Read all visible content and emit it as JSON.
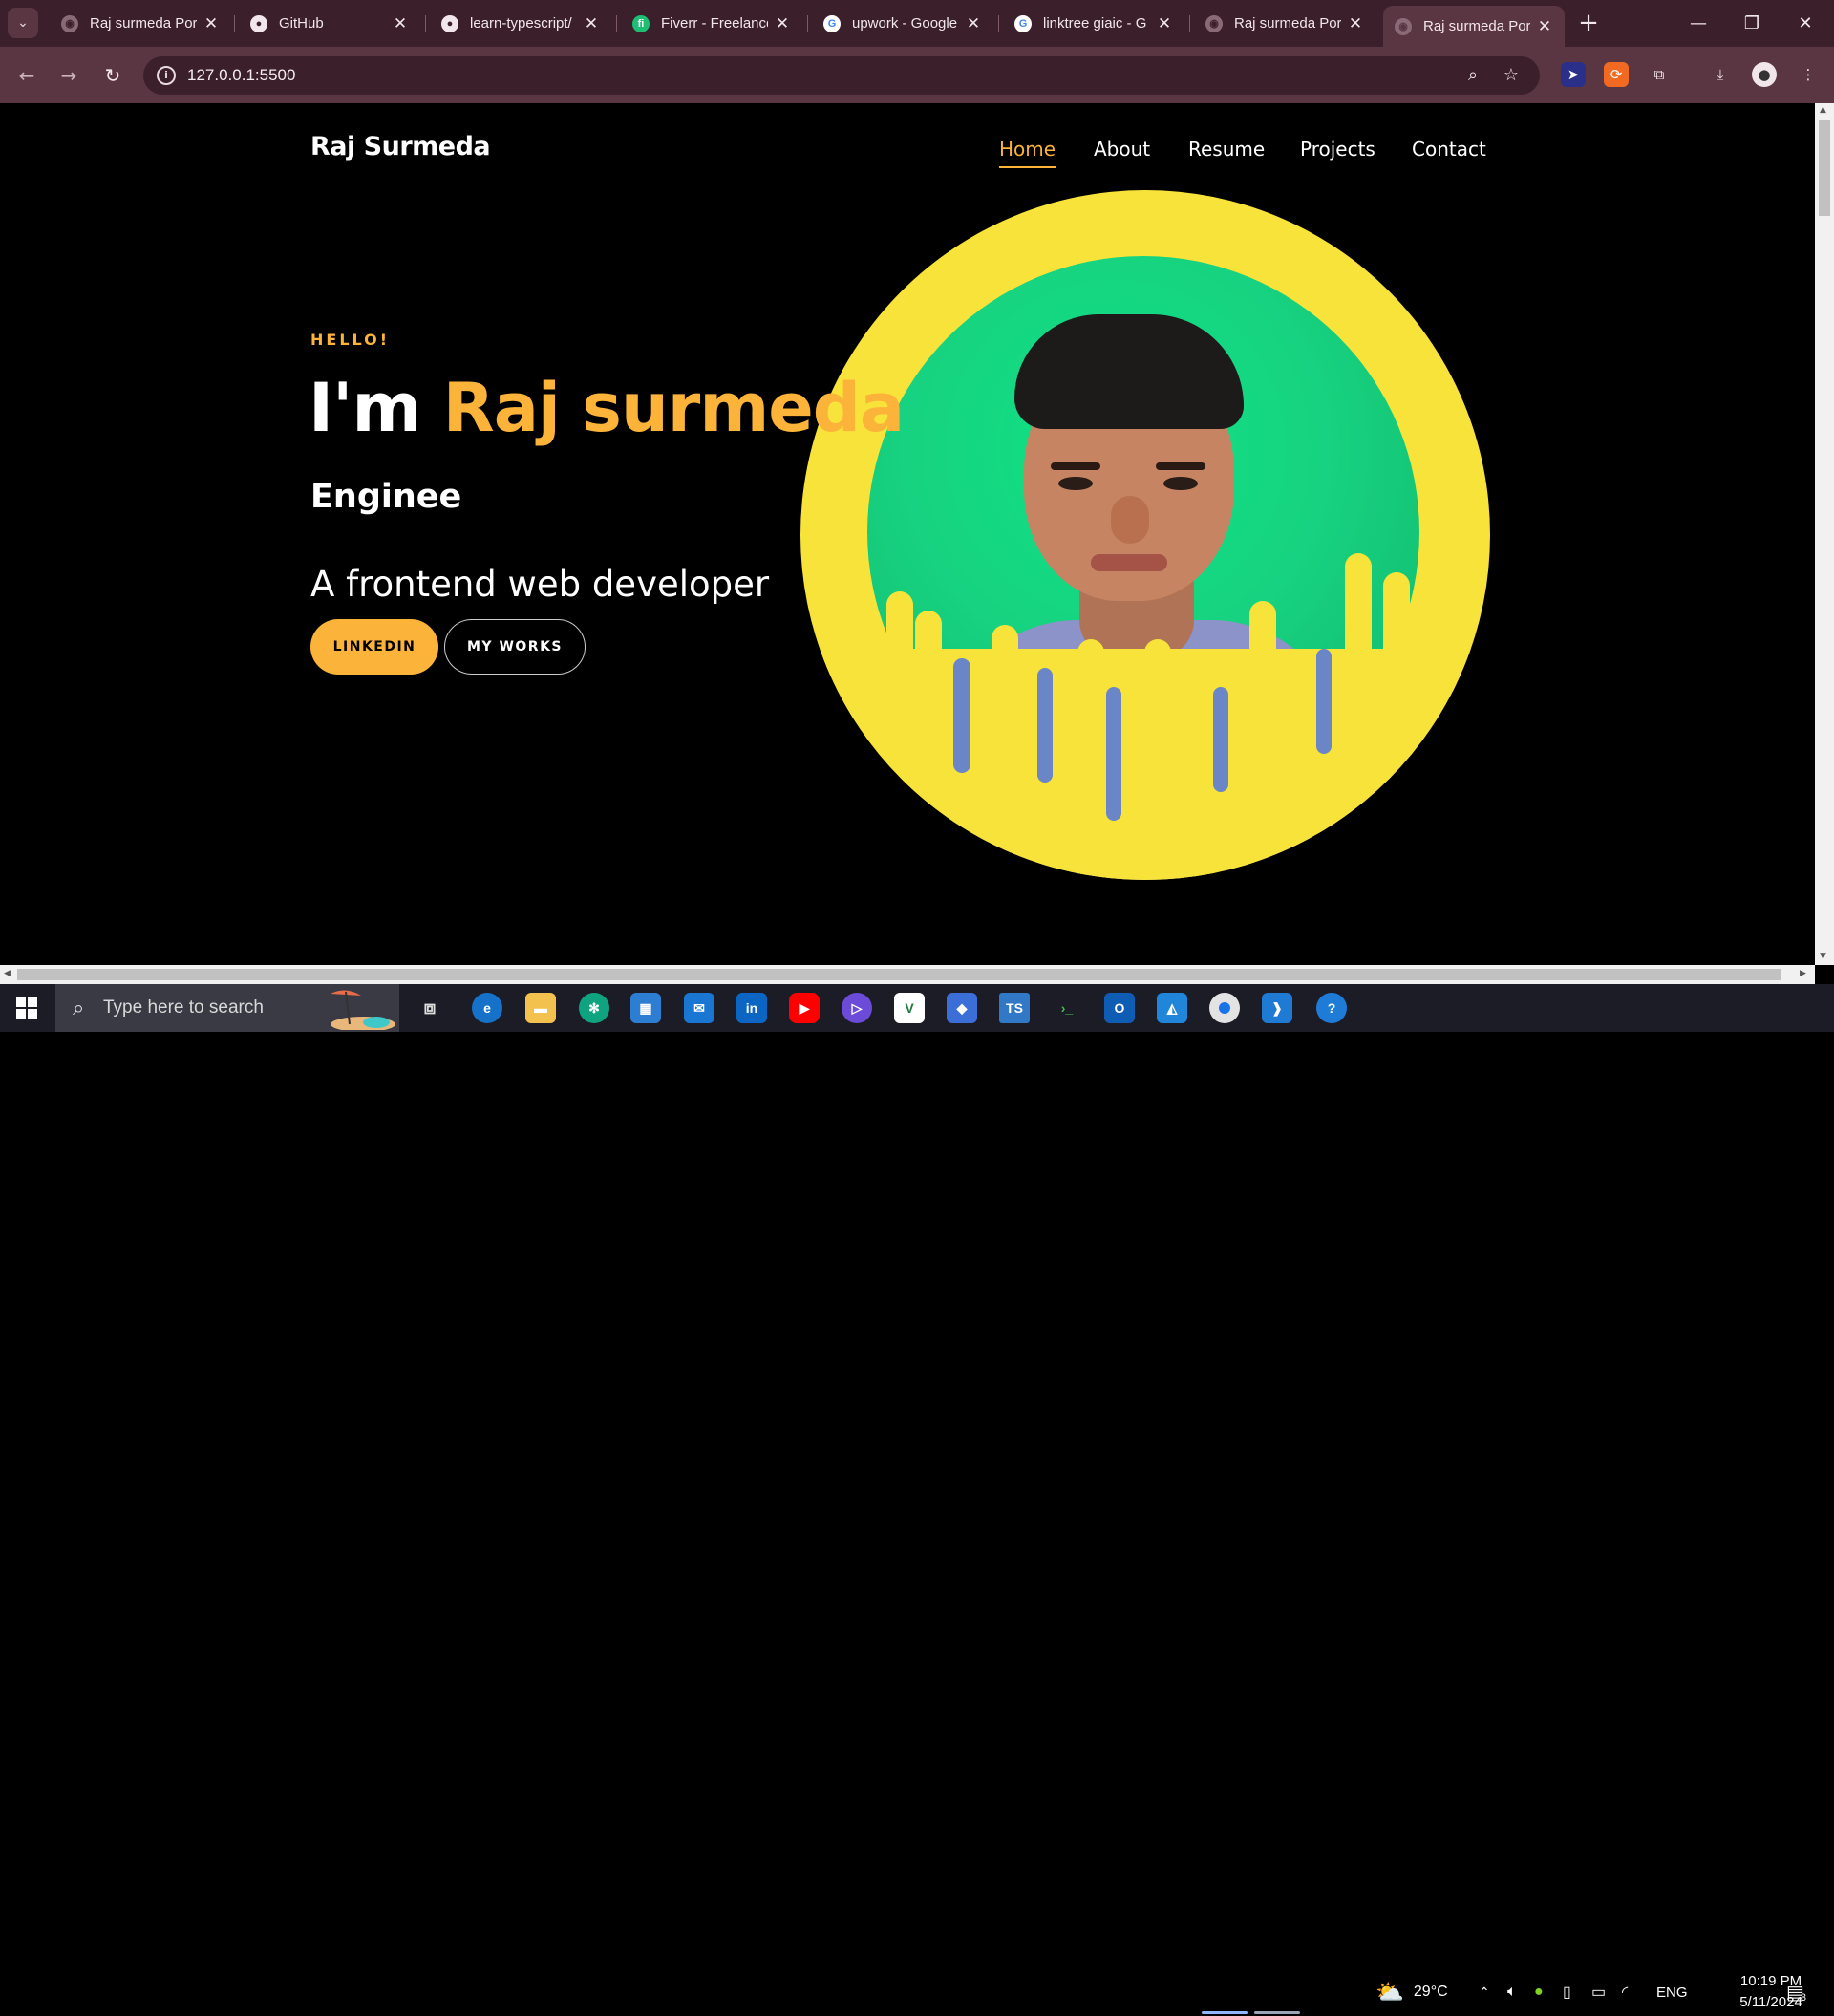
{
  "browser": {
    "tabs": [
      {
        "title": "Raj surmeda Port",
        "favicon": "globe"
      },
      {
        "title": "GitHub",
        "favicon": "github"
      },
      {
        "title": "learn-typescript/",
        "favicon": "github"
      },
      {
        "title": "Fiverr - Freelance",
        "favicon": "fiverr"
      },
      {
        "title": "upwork - Google",
        "favicon": "google"
      },
      {
        "title": "linktree giaic - G",
        "favicon": "google"
      },
      {
        "title": "Raj surmeda Port",
        "favicon": "globe"
      },
      {
        "title": "Raj surmeda Port",
        "favicon": "globe",
        "active": true
      }
    ],
    "url": "127.0.0.1:5500"
  },
  "site": {
    "logo": "Raj Surmeda",
    "nav": [
      "Home",
      "About",
      "Resume",
      "Projects",
      "Contact"
    ],
    "active_nav": "Home",
    "hero": {
      "greeting": "HELLO!",
      "intro": "I'm ",
      "name": "Raj surmeda",
      "role": "Enginee",
      "description": "A frontend web developer",
      "primary_button": "LINKEDIN",
      "secondary_button": "MY WORKS"
    },
    "colors": {
      "accent": "#fbb339",
      "background": "#000000",
      "portrait_ring": "#f8e33a",
      "portrait_bg": "#17d280"
    }
  },
  "taskbar": {
    "search_placeholder": "Type here to search",
    "weather": "29°C",
    "language": "ENG",
    "time": "10:19 PM",
    "date": "5/11/2024",
    "notifications": "3"
  }
}
